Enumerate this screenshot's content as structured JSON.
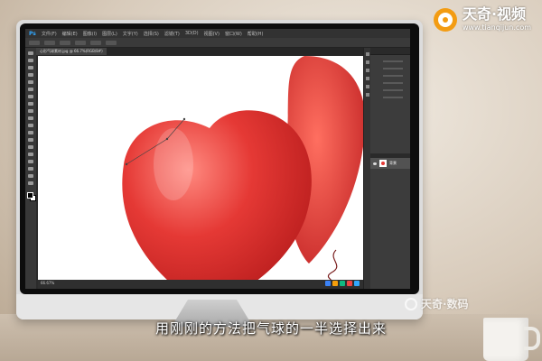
{
  "brand": {
    "name": "天奇·视频",
    "url": "www.tianqijun.com"
  },
  "brand_secondary": {
    "name": "天奇·数码"
  },
  "subtitle": "用刚刚的方法把气球的一半选择出来",
  "app": {
    "logo": "Ps",
    "menus": [
      "文件(F)",
      "编辑(E)",
      "图像(I)",
      "图层(L)",
      "文字(Y)",
      "选择(S)",
      "滤镜(T)",
      "3D(D)",
      "视图(V)",
      "窗口(W)",
      "帮助(H)"
    ],
    "document_tab": "心形气球素材.jpg @ 66.7%(RGB/8#)",
    "zoom": "66.67%",
    "layer_name": "背景"
  },
  "colors": {
    "accent": "#f39c12",
    "balloon": "#e53935",
    "ps_blue": "#31a8ff"
  },
  "icons": [
    "brand-logo-icon",
    "move-tool-icon",
    "eye-icon",
    "foreground-color-icon",
    "background-color-icon"
  ]
}
